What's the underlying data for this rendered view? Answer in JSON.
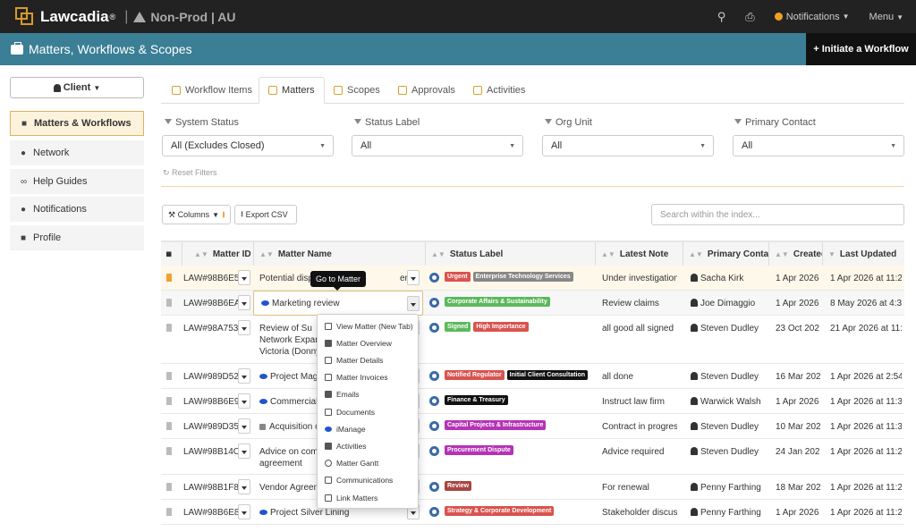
{
  "app": {
    "brand": "Lawcadia",
    "trademark": "®",
    "separator": "|",
    "environment": "Non-Prod | AU",
    "notifications_label": "Notifications",
    "menu_label": "Menu"
  },
  "titlebar": {
    "title": "Matters, Workflows & Scopes",
    "initiate_label": "+ Initiate a Workflow"
  },
  "sidebar": {
    "client_label": "Client",
    "items": [
      {
        "label": "Matters & Workflows",
        "icon": "briefcase-icon",
        "active": true
      },
      {
        "label": "Network",
        "icon": "globe-icon"
      },
      {
        "label": "Help Guides",
        "icon": "link-icon"
      },
      {
        "label": "Notifications",
        "icon": "info-icon"
      },
      {
        "label": "Profile",
        "icon": "user-icon"
      }
    ]
  },
  "tabs": [
    {
      "label": "Workflow Items",
      "active": false
    },
    {
      "label": "Matters",
      "active": true
    },
    {
      "label": "Scopes",
      "active": false
    },
    {
      "label": "Approvals",
      "active": false
    },
    {
      "label": "Activities",
      "active": false
    }
  ],
  "filters": [
    {
      "label": "System Status",
      "value": "All (Excludes Closed)"
    },
    {
      "label": "Status Label",
      "value": "All"
    },
    {
      "label": "Org Unit",
      "value": "All"
    },
    {
      "label": "Primary Contact",
      "value": "All"
    }
  ],
  "reset_filters_label": "Reset Filters",
  "toolbar": {
    "columns_label": "Columns",
    "export_label": "Export CSV",
    "search_placeholder": "Search within the index..."
  },
  "table": {
    "headers": [
      "Matter ID",
      "Matter Name",
      "Status Label",
      "Latest Note",
      "Primary Contact",
      "Created a",
      "Last Updated"
    ],
    "rows": [
      {
        "id": "LAW#98B6E5",
        "name": "Potential disp",
        "name_suffix": "er",
        "note": "Under investigation",
        "contact": "Sacha Kirk",
        "created": "1 Apr 2026",
        "updated": "1 Apr 2026 at 11:2",
        "badges": [
          {
            "text": "Urgent",
            "color": "#d9534f"
          },
          {
            "text": "Enterprise Technology Services",
            "color": "#888888"
          }
        ]
      },
      {
        "id": "LAW#98B6EA",
        "name": "Marketing review",
        "note": "Review claims",
        "contact": "Joe Dimaggio",
        "created": "1 Apr 2026",
        "updated": "8 May 2026 at 4:3",
        "badges": [
          {
            "text": "Corporate Affairs & Sustainability",
            "color": "#5cb85c"
          }
        ]
      },
      {
        "id": "LAW#98A753",
        "name": "Review of Su",
        "name_line2": "Network Expans",
        "name_line3": "Victoria (Donnyb",
        "note": "all good all signed",
        "contact": "Steven Dudley",
        "created": "23 Oct 202",
        "updated": "21 Apr 2026 at 11:",
        "badges": [
          {
            "text": "Signed",
            "color": "#5cb85c"
          },
          {
            "text": "High Importance",
            "color": "#d9534f"
          }
        ]
      },
      {
        "id": "LAW#989D52",
        "name": "Project Mage",
        "note": "all done",
        "contact": "Steven Dudley",
        "created": "16 Mar 202",
        "updated": "1 Apr 2026 at 2:54",
        "badges": [
          {
            "text": "Notified Regulator",
            "color": "#d9534f"
          },
          {
            "text": "Initial Client Consultation",
            "color": "#111111"
          }
        ]
      },
      {
        "id": "LAW#98B6E9",
        "name": "Commercial",
        "note": "Instruct law firm",
        "contact": "Warwick Walsh",
        "created": "1 Apr 2026",
        "updated": "1 Apr 2026 at 11:3",
        "badges": [
          {
            "text": "Finance & Treasury",
            "color": "#111111"
          }
        ]
      },
      {
        "id": "LAW#989D35",
        "name": "Acquisition o",
        "note": "Contract in progress",
        "contact": "Steven Dudley",
        "created": "10 Mar 202",
        "updated": "1 Apr 2026 at 11:3",
        "badges": [
          {
            "text": "Capital Projects & Infrastructure",
            "color": "#b533b5"
          }
        ]
      },
      {
        "id": "LAW#98B14C",
        "name": "Advice on comm",
        "name_line2": "agreement",
        "note": "Advice required",
        "contact": "Steven Dudley",
        "created": "24 Jan 202",
        "updated": "1 Apr 2026 at 11:2",
        "badges": [
          {
            "text": "Procurement Dispute",
            "color": "#b533b5"
          }
        ]
      },
      {
        "id": "LAW#98B1F8",
        "name": "Vendor Agreem",
        "note": "For renewal",
        "contact": "Penny Farthing",
        "created": "18 Mar 202",
        "updated": "1 Apr 2026 at 11:2",
        "badges": [
          {
            "text": "Review",
            "color": "#a94442"
          }
        ]
      },
      {
        "id": "LAW#98B6E8",
        "name": "Project Silver Lining",
        "note": "Stakeholder discussi",
        "contact": "Penny Farthing",
        "created": "1 Apr 2026",
        "updated": "1 Apr 2026 at 11:2",
        "badges": [
          {
            "text": "Strategy & Corporate Development",
            "color": "#d9534f"
          }
        ]
      }
    ]
  },
  "tooltip": "Go to Matter",
  "context_menu": [
    "View Matter (New Tab)",
    "Matter Overview",
    "Matter Details",
    "Matter Invoices",
    "Emails",
    "Documents",
    "iManage",
    "Activities",
    "Matter Gantt",
    "Communications",
    "Link Matters"
  ]
}
